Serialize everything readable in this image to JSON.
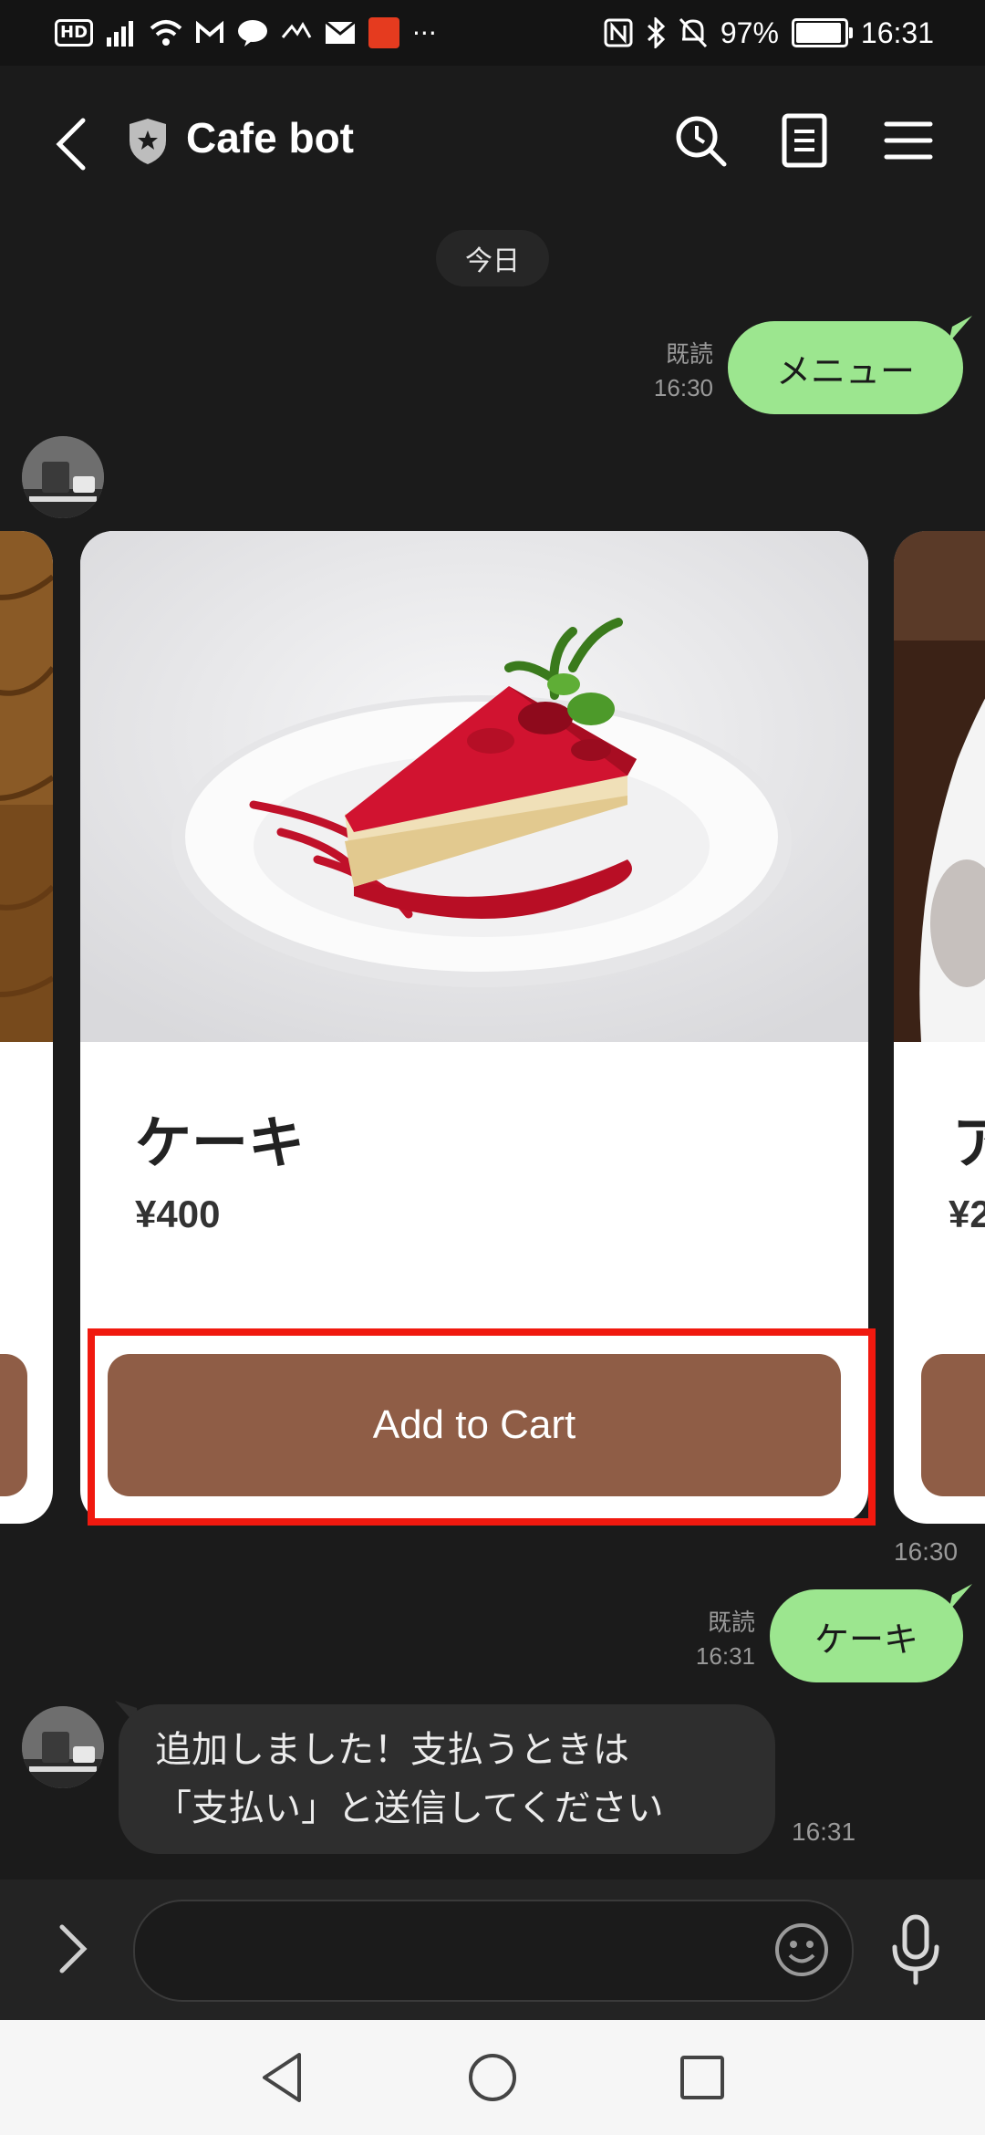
{
  "status_bar": {
    "hd": "HD",
    "battery": "97%",
    "time": "16:31",
    "more": "···"
  },
  "header": {
    "title": "Cafe bot"
  },
  "date_separator": "今日",
  "messages": {
    "user1": {
      "text": "メニュー",
      "read": "既読",
      "time": "16:30"
    },
    "carousel_time": "16:30",
    "user2": {
      "text": "ケーキ",
      "read": "既読",
      "time": "16:31"
    },
    "bot_reply": {
      "line1": "追加しました！支払うときは",
      "line2": "「支払い」と送信してください",
      "time": "16:31"
    }
  },
  "carousel": {
    "cards": [
      {
        "name": "ケーキ",
        "price": "¥400",
        "button": "Add to Cart"
      },
      {
        "name_partial": "ア",
        "price_partial": "¥2"
      }
    ]
  },
  "colors": {
    "background": "#1b1b1b",
    "user_bubble": "#9ce68f",
    "bot_bubble": "#2e2e2e",
    "button": "#8f5d46",
    "highlight": "#f0190f"
  },
  "icons": [
    "back-icon",
    "shield-icon",
    "search-icon",
    "notes-icon",
    "menu-icon",
    "expand-icon",
    "emoji-icon",
    "mic-icon",
    "nav-back-icon",
    "nav-home-icon",
    "nav-recents-icon"
  ]
}
